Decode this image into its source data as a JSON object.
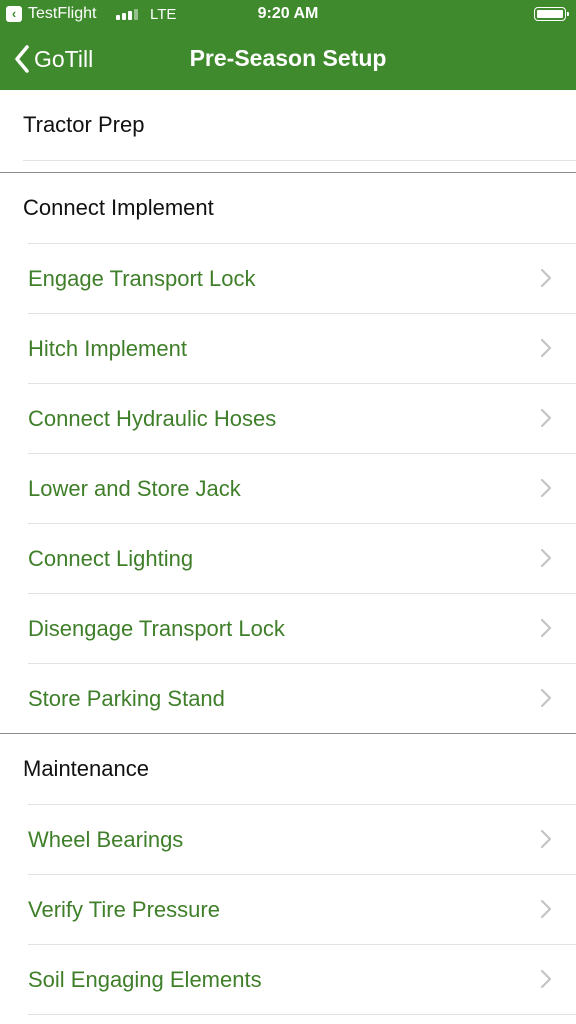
{
  "status_bar": {
    "back_app_label": "TestFlight",
    "back_app_icon": "back-arrow-icon",
    "network": "LTE",
    "time": "9:20 AM",
    "signal_icon": "cellular-signal-icon",
    "signal_bars_filled": 3,
    "battery_icon": "battery-icon",
    "battery_level": 1.0
  },
  "nav": {
    "back_label": "GoTill",
    "title": "Pre-Season Setup"
  },
  "sections": {
    "tractor_prep": {
      "title": "Tractor Prep"
    },
    "connect_implement": {
      "title": "Connect Implement",
      "items": [
        {
          "label": "Engage Transport Lock"
        },
        {
          "label": "Hitch Implement"
        },
        {
          "label": "Connect Hydraulic Hoses"
        },
        {
          "label": "Lower and Store Jack"
        },
        {
          "label": "Connect Lighting"
        },
        {
          "label": "Disengage Transport Lock"
        },
        {
          "label": "Store Parking Stand"
        }
      ]
    },
    "maintenance": {
      "title": "Maintenance",
      "items": [
        {
          "label": "Wheel Bearings"
        },
        {
          "label": "Verify Tire Pressure"
        },
        {
          "label": "Soil Engaging Elements"
        }
      ]
    }
  },
  "colors": {
    "brand_green": "#3f8a2d",
    "item_text_green": "#3f7f2a",
    "chevron_gray": "#c4c4c4"
  }
}
